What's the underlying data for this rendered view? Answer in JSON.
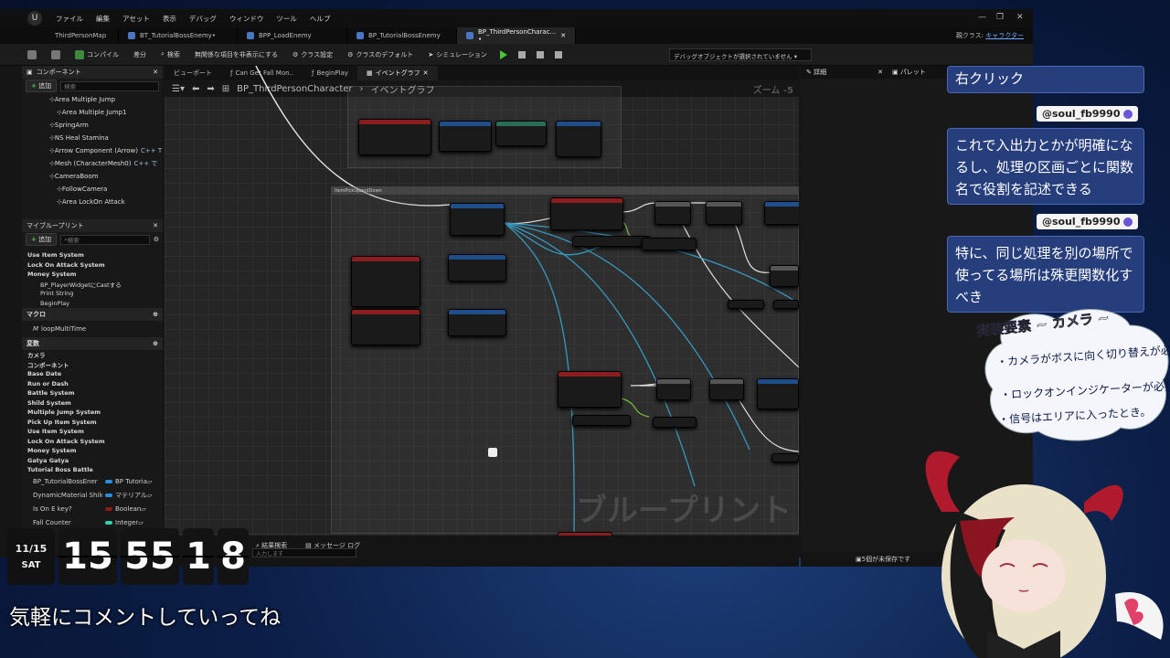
{
  "app": {
    "menu": [
      "ファイル",
      "編集",
      "アセット",
      "表示",
      "デバッグ",
      "ウィンドウ",
      "ツール",
      "ヘルプ"
    ],
    "doc_tabs": [
      {
        "label": "ThirdPersonMap",
        "active": false
      },
      {
        "label": "BT_TutorialBossEnemy•",
        "active": false
      },
      {
        "label": "BPP_LoadEnemy",
        "active": false
      },
      {
        "label": "BP_TutorialBossEnemy",
        "active": false
      },
      {
        "label": "BP_ThirdPersonCharac... •",
        "active": true
      }
    ],
    "parent_class_label": "親クラス:",
    "parent_class_value": "キャラクター"
  },
  "toolbar": {
    "compile": "コンパイル",
    "diff": "差分",
    "find": "検索",
    "hide_unrelated": "無関係な項目を非表示にする",
    "class_settings": "クラス設定",
    "class_defaults": "クラスのデフォルト",
    "simulation": "シミュレーション",
    "debug_object": "デバッグオブジェクトが選択されていません"
  },
  "components": {
    "title": "コンポーネント",
    "add": "追加",
    "search_placeholder": "検索",
    "items": [
      {
        "label": "Area Multiple Jump",
        "indent": 30
      },
      {
        "label": "Area Multiple Jump1",
        "indent": 38
      },
      {
        "label": "SpringArm",
        "indent": 30
      },
      {
        "label": "NS Heal Stamina",
        "indent": 30
      },
      {
        "label": "Arrow Component (Arrow)",
        "cpp": "C++ T",
        "indent": 30
      },
      {
        "label": "Mesh (CharacterMesh0)",
        "cpp": "C++ で",
        "indent": 30
      },
      {
        "label": "CameraBoom",
        "indent": 30
      },
      {
        "label": "FollowCamera",
        "indent": 38
      },
      {
        "label": "Area LockOn Attack",
        "indent": 38
      }
    ]
  },
  "my_blueprint": {
    "title": "マイブループリント",
    "add": "追加",
    "search_placeholder": "検索",
    "graph_items": [
      {
        "label": "Use Item System",
        "bold": true
      },
      {
        "label": "Lock On Attack System",
        "bold": true
      },
      {
        "label": "Money System",
        "bold": true
      },
      {
        "label": "BP_PlayerWidgetにCastする",
        "bold": false
      },
      {
        "label": "Print String",
        "bold": false
      },
      {
        "label": "BeginPlay",
        "bold": false
      }
    ],
    "macro_title": "マクロ",
    "macros": [
      "loopMultiTime"
    ],
    "vars_title": "変数",
    "var_categories": [
      "カメラ",
      "コンポーネント",
      "Base Date",
      "Run or Dash",
      "Battle System",
      "Shild System",
      "Multiple Jump System",
      "Pick Up Item System",
      "Use Item System",
      "Lock On Attack System",
      "Money System",
      "Gatya Gatya",
      "Tutorial Boss Battle"
    ],
    "variables": [
      {
        "name": "BP_TutorialBossEner",
        "type": "BP Tutoria",
        "color": "#2a8ee0"
      },
      {
        "name": "DynamicMaterial Shild",
        "type": "マテリアル",
        "color": "#2a8ee0"
      },
      {
        "name": "Is On E key?",
        "type": "Boolean",
        "color": "#8b1a1a"
      },
      {
        "name": "Fall Counter",
        "type": "Integer",
        "color": "#2fd6a8"
      }
    ]
  },
  "graph": {
    "tabs": [
      {
        "label": "ビューポート",
        "active": false
      },
      {
        "label": "Can Get Fall Mon..",
        "active": false
      },
      {
        "label": "BeginPlay",
        "active": false
      },
      {
        "label": "イベントグラフ",
        "active": true
      }
    ],
    "breadcrumb_root": "BP_ThirdPersonCharacter",
    "breadcrumb_leaf": "イベントグラフ",
    "zoom": "ズーム -5",
    "watermark": "ブループリント",
    "comment_label": "ItemPickUpandDown"
  },
  "details": {
    "tab1": "詳細",
    "tab2": "パレット"
  },
  "statusbar": {
    "find_results": "結果検索",
    "message_log": "メッセージ ログ",
    "placeholder": "入力します",
    "unsaved": "5個が未保存です"
  },
  "chat": [
    {
      "user": null,
      "text": "右クリック"
    },
    {
      "user": "@soul_fb9990",
      "text": "これで入出力とかが明確になるし、処理の区画ごとに関数名で役割を記述できる"
    },
    {
      "user": "@soul_fb9990",
      "text": "特に、同じ処理を別の場所で使ってる場所は殊更関数化すべき"
    }
  ],
  "memo": {
    "title": "実装要素 ~ カメラ ~",
    "lines": [
      "・カメラがボスに向く切り替えが必要。",
      "・ロックオンインジケーターが必要。",
      "・信号はエリアに入ったとき。"
    ]
  },
  "clock": {
    "date": "11/15",
    "day": "SAT",
    "hh": "15",
    "mm": "55",
    "ss1": "1",
    "ss2": "8"
  },
  "overlay_text": "気軽にコメントしていってね"
}
